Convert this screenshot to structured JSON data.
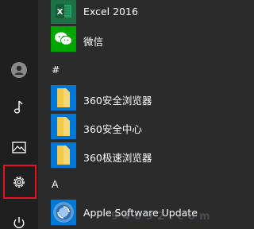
{
  "apps": {
    "excel": {
      "label": "Excel 2016",
      "icon": "excel-icon",
      "color": "#1e7145"
    },
    "wechat": {
      "label": "微信",
      "icon": "wechat-icon",
      "color": "#00a600"
    },
    "section_hash": "#",
    "browser360": {
      "label": "360安全浏览器",
      "icon": "folder-icon"
    },
    "center360": {
      "label": "360安全中心",
      "icon": "folder-icon"
    },
    "extreme360": {
      "label": "360极速浏览器",
      "icon": "folder-icon"
    },
    "section_a": "A",
    "apple_update": {
      "label": "Apple Software Update",
      "icon": "apple-update-icon"
    }
  },
  "rail": {
    "items": [
      "user-icon",
      "music-icon",
      "pictures-icon",
      "settings-icon",
      "power-icon"
    ],
    "highlight_color": "#e81123"
  },
  "watermark": "9 4 0 9 2 . c o m",
  "colors": {
    "tile_blue": "#0078d7",
    "folder_yellow": "#f8d775",
    "background": "#2b2b2b"
  }
}
